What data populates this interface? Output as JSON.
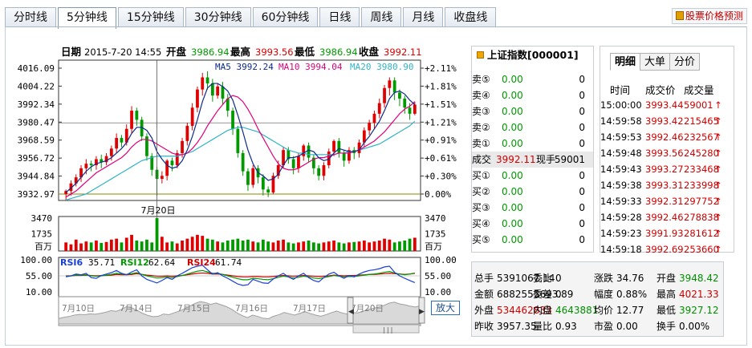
{
  "tabs": [
    "分时线",
    "5分钟线",
    "15分钟线",
    "30分钟线",
    "60分钟线",
    "日线",
    "周线",
    "月线",
    "收盘线"
  ],
  "active_tab": 1,
  "predict_label": "股票价格预测",
  "kline": {
    "date_label": "日期",
    "date_value": "2015-7-20 14:55",
    "open_label": "开盘",
    "open_value": "3986.94",
    "high_label": "最高",
    "high_value": "3993.56",
    "low_label": "最低",
    "low_value": "3986.94",
    "close_label": "收盘",
    "close_value": "3992.11",
    "ma5_label": "MA5",
    "ma5_value": "3992.24",
    "ma10_label": "MA10",
    "ma10_value": "3994.04",
    "ma20_label": "MA20",
    "ma20_value": "3980.90",
    "date_marker": "7月20日",
    "vol_unit": "百万",
    "rsi6_label": "RSI6",
    "rsi6_value": "35.71",
    "rsi12_label": "RSI12",
    "rsi12_value": "62.64",
    "rsi24_label": "RSI24",
    "rsi24_value": "61.74",
    "expand_label": "放大",
    "nav_dates": [
      "7月10日",
      "7月14日",
      "7月15日",
      "7月16日",
      "7月17日",
      "7月20日"
    ],
    "colors": {
      "up": "#e00000",
      "down": "#009900",
      "ma5": "#0b2a8c",
      "ma10": "#e0007a",
      "ma20": "#2fb3c8",
      "rsi6": "#1a3fd8",
      "rsi12": "#009900",
      "rsi24": "#d00000"
    }
  },
  "chart_data": {
    "type": "candlestick",
    "price_ticks": [
      "4016.09",
      "4004.22",
      "3992.34",
      "3980.47",
      "3968.59",
      "3956.72",
      "3944.84",
      "3932.97"
    ],
    "pct_ticks": [
      "+2.11%",
      "+1.81%",
      "+1.51%",
      "+1.21%",
      "+0.91%",
      "+0.61%",
      "+0.30%",
      "0.00%"
    ],
    "price_range": [
      3932.97,
      4016.09
    ],
    "volume_ticks": [
      "3470",
      "1735"
    ],
    "volume_range": [
      0,
      3470
    ],
    "rsi_ticks": [
      "100.00",
      "55.00",
      "10.00"
    ],
    "rsi_range": [
      10,
      100
    ],
    "candles": [
      [
        3933,
        3935,
        3929,
        3936
      ],
      [
        3935,
        3940,
        3932,
        3942
      ],
      [
        3940,
        3944,
        3938,
        3946
      ],
      [
        3944,
        3950,
        3941,
        3952
      ],
      [
        3950,
        3953,
        3946,
        3956
      ],
      [
        3953,
        3952,
        3948,
        3955
      ],
      [
        3952,
        3956,
        3949,
        3958
      ],
      [
        3956,
        3954,
        3950,
        3959
      ],
      [
        3954,
        3958,
        3952,
        3960
      ],
      [
        3958,
        3963,
        3955,
        3965
      ],
      [
        3963,
        3970,
        3960,
        3973
      ],
      [
        3970,
        3967,
        3964,
        3972
      ],
      [
        3967,
        3976,
        3965,
        3979
      ],
      [
        3976,
        3988,
        3973,
        3991
      ],
      [
        3988,
        3982,
        3978,
        3990
      ],
      [
        3982,
        3971,
        3968,
        3984
      ],
      [
        3971,
        3958,
        3955,
        3973
      ],
      [
        3958,
        3949,
        3945,
        3960
      ],
      [
        3949,
        3943,
        3932,
        3951
      ],
      [
        3943,
        3945,
        3940,
        3948
      ],
      [
        3945,
        3955,
        3942,
        3956
      ],
      [
        3955,
        3952,
        3948,
        3957
      ],
      [
        3952,
        3960,
        3950,
        3962
      ],
      [
        3960,
        3968,
        3957,
        3970
      ],
      [
        3968,
        3978,
        3965,
        3980
      ],
      [
        3978,
        3990,
        3975,
        3993
      ],
      [
        3990,
        4002,
        3987,
        4004
      ],
      [
        4002,
        4010,
        3998,
        4013
      ],
      [
        4010,
        4006,
        4002,
        4014
      ],
      [
        4006,
        3998,
        3994,
        4009
      ],
      [
        3998,
        4004,
        3996,
        4006
      ],
      [
        4004,
        3996,
        3992,
        4007
      ],
      [
        3996,
        3988,
        3984,
        3999
      ],
      [
        3988,
        3976,
        3972,
        3990
      ],
      [
        3976,
        3960,
        3957,
        3978
      ],
      [
        3960,
        3948,
        3945,
        3962
      ],
      [
        3948,
        3939,
        3935,
        3950
      ],
      [
        3939,
        3950,
        3937,
        3952
      ],
      [
        3950,
        3944,
        3940,
        3952
      ],
      [
        3944,
        3936,
        3932,
        3946
      ],
      [
        3936,
        3934,
        3931,
        3938
      ],
      [
        3934,
        3945,
        3933,
        3947
      ],
      [
        3945,
        3952,
        3943,
        3955
      ],
      [
        3952,
        3962,
        3950,
        3964
      ],
      [
        3962,
        3956,
        3953,
        3964
      ],
      [
        3956,
        3950,
        3946,
        3958
      ],
      [
        3950,
        3958,
        3947,
        3960
      ],
      [
        3958,
        3965,
        3955,
        3966
      ],
      [
        3965,
        3957,
        3954,
        3967
      ],
      [
        3957,
        3950,
        3946,
        3959
      ],
      [
        3950,
        3945,
        3942,
        3952
      ],
      [
        3945,
        3952,
        3942,
        3954
      ],
      [
        3952,
        3961,
        3950,
        3963
      ],
      [
        3961,
        3968,
        3958,
        3969
      ],
      [
        3968,
        3960,
        3957,
        3970
      ],
      [
        3960,
        3955,
        3951,
        3962
      ],
      [
        3955,
        3962,
        3953,
        3964
      ],
      [
        3962,
        3960,
        3956,
        3964
      ],
      [
        3960,
        3967,
        3957,
        3969
      ],
      [
        3967,
        3975,
        3964,
        3977
      ],
      [
        3975,
        3980,
        3972,
        3982
      ],
      [
        3980,
        3986,
        3976,
        3988
      ],
      [
        3986,
        3993,
        3983,
        3996
      ],
      [
        3993,
        4003,
        3990,
        4005
      ],
      [
        4003,
        4008,
        3998,
        4010
      ],
      [
        4008,
        4000,
        3995,
        4010
      ],
      [
        4000,
        3996,
        3991,
        4002
      ],
      [
        3996,
        3990,
        3986,
        3998
      ],
      [
        3990,
        3986,
        3982,
        3993
      ],
      [
        3986,
        3992,
        3985,
        3994
      ]
    ],
    "ma5": [
      3934,
      3937,
      3940,
      3944,
      3948,
      3951,
      3953,
      3954,
      3955,
      3957,
      3960,
      3963,
      3967,
      3973,
      3977,
      3977,
      3975,
      3970,
      3961,
      3956,
      3952,
      3950,
      3951,
      3955,
      3962,
      3971,
      3982,
      3994,
      4003,
      4006,
      4006,
      4004,
      4001,
      3995,
      3985,
      3974,
      3962,
      3953,
      3947,
      3945,
      3942,
      3943,
      3946,
      3952,
      3957,
      3957,
      3958,
      3960,
      3962,
      3961,
      3957,
      3955,
      3956,
      3960,
      3963,
      3962,
      3961,
      3961,
      3962,
      3967,
      3971,
      3976,
      3981,
      3988,
      3996,
      4000,
      4001,
      3999,
      3995,
      3992
    ],
    "ma10": [
      3931,
      3933,
      3935,
      3938,
      3941,
      3944,
      3947,
      3949,
      3951,
      3953,
      3955,
      3957,
      3960,
      3964,
      3967,
      3969,
      3969,
      3968,
      3966,
      3964,
      3962,
      3960,
      3959,
      3959,
      3960,
      3963,
      3967,
      3972,
      3978,
      3983,
      3988,
      3992,
      3996,
      3998,
      3997,
      3994,
      3989,
      3983,
      3976,
      3970,
      3964,
      3958,
      3953,
      3950,
      3949,
      3949,
      3950,
      3952,
      3954,
      3956,
      3957,
      3957,
      3958,
      3959,
      3960,
      3960,
      3960,
      3961,
      3962,
      3964,
      3966,
      3968,
      3971,
      3974,
      3978,
      3982,
      3986,
      3989,
      3991,
      3994
    ],
    "ma20": [
      3929,
      3930,
      3931,
      3932,
      3933,
      3935,
      3937,
      3939,
      3941,
      3943,
      3945,
      3947,
      3949,
      3951,
      3953,
      3955,
      3956,
      3957,
      3958,
      3958,
      3958,
      3958,
      3958,
      3959,
      3960,
      3961,
      3963,
      3965,
      3967,
      3969,
      3971,
      3973,
      3975,
      3976,
      3977,
      3977,
      3976,
      3975,
      3974,
      3972,
      3970,
      3968,
      3966,
      3964,
      3962,
      3961,
      3960,
      3960,
      3959,
      3959,
      3959,
      3959,
      3959,
      3959,
      3960,
      3960,
      3961,
      3961,
      3962,
      3963,
      3964,
      3965,
      3966,
      3968,
      3970,
      3972,
      3974,
      3976,
      3978,
      3981
    ],
    "volume": [
      900,
      700,
      1200,
      800,
      1000,
      900,
      1100,
      850,
      950,
      1200,
      1300,
      900,
      1400,
      1700,
      1100,
      1000,
      1200,
      900,
      3470,
      1500,
      900,
      1000,
      800,
      1100,
      1300,
      1500,
      1700,
      1600,
      1300,
      1200,
      1000,
      900,
      1100,
      1200,
      1300,
      1100,
      1200,
      1000,
      900,
      1200,
      1000,
      900,
      1100,
      1200,
      900,
      800,
      900,
      1000,
      1100,
      900,
      800,
      900,
      1000,
      1100,
      900,
      800,
      900,
      950,
      1000,
      1100,
      900,
      1000,
      1100,
      1300,
      1200,
      900,
      1000,
      1100,
      1300,
      1400
    ],
    "rsi6": [
      52,
      55,
      60,
      58,
      62,
      50,
      48,
      56,
      60,
      64,
      70,
      62,
      58,
      66,
      72,
      55,
      45,
      40,
      35,
      42,
      50,
      45,
      55,
      62,
      70,
      78,
      82,
      85,
      72,
      60,
      64,
      55,
      48,
      40,
      32,
      28,
      30,
      45,
      40,
      35,
      34,
      46,
      55,
      62,
      52,
      45,
      55,
      62,
      50,
      42,
      38,
      50,
      60,
      65,
      55,
      48,
      56,
      52,
      60,
      66,
      70,
      72,
      75,
      80,
      82,
      65,
      55,
      48,
      42,
      36
    ],
    "rsi12": [
      54,
      55,
      57,
      57,
      58,
      55,
      54,
      55,
      57,
      59,
      62,
      60,
      59,
      61,
      64,
      59,
      55,
      52,
      49,
      50,
      52,
      50,
      53,
      56,
      60,
      64,
      68,
      70,
      66,
      62,
      62,
      59,
      55,
      51,
      47,
      44,
      44,
      48,
      47,
      45,
      44,
      47,
      51,
      54,
      52,
      49,
      51,
      54,
      52,
      49,
      47,
      50,
      53,
      56,
      54,
      52,
      53,
      53,
      55,
      57,
      59,
      60,
      62,
      65,
      67,
      63,
      60,
      58,
      60,
      63
    ],
    "rsi24": [
      55,
      55,
      56,
      56,
      57,
      56,
      55,
      56,
      56,
      57,
      59,
      58,
      58,
      59,
      61,
      59,
      57,
      56,
      54,
      54,
      55,
      54,
      55,
      56,
      58,
      60,
      62,
      63,
      62,
      60,
      60,
      59,
      57,
      55,
      53,
      52,
      52,
      53,
      53,
      52,
      52,
      53,
      55,
      56,
      55,
      54,
      55,
      56,
      55,
      54,
      53,
      54,
      55,
      57,
      56,
      55,
      56,
      56,
      57,
      58,
      59,
      59,
      60,
      61,
      62,
      61,
      60,
      59,
      60,
      62
    ]
  },
  "quote": {
    "title": "上证指数[000001]",
    "sell": [
      {
        "label": "卖⑤",
        "price": "0.00",
        "vol": "0"
      },
      {
        "label": "卖④",
        "price": "0.00",
        "vol": "0"
      },
      {
        "label": "卖③",
        "price": "0.00",
        "vol": "0"
      },
      {
        "label": "卖②",
        "price": "0.00",
        "vol": "0"
      },
      {
        "label": "卖①",
        "price": "0.00",
        "vol": "0"
      }
    ],
    "deal_label": "成交",
    "deal_price": "3992.11",
    "now_label": "现手",
    "now_vol": "59001",
    "buy": [
      {
        "label": "买①",
        "price": "0.00",
        "vol": "0"
      },
      {
        "label": "买②",
        "price": "0.00",
        "vol": "0"
      },
      {
        "label": "买③",
        "price": "0.00",
        "vol": "0"
      },
      {
        "label": "买④",
        "price": "0.00",
        "vol": "0"
      },
      {
        "label": "买⑤",
        "price": "0.00",
        "vol": "0"
      }
    ]
  },
  "detail": {
    "tabs": [
      "明细",
      "大单",
      "分价"
    ],
    "headers": [
      "时间",
      "成交价",
      "成交量"
    ],
    "rows": [
      {
        "time": "15:00:00",
        "price": "3993.44",
        "vol": "59001"
      },
      {
        "time": "14:59:58",
        "price": "3993.42",
        "vol": "215465"
      },
      {
        "time": "14:59:53",
        "price": "3992.46",
        "vol": "232567"
      },
      {
        "time": "14:59:48",
        "price": "3993.56",
        "vol": "245280"
      },
      {
        "time": "14:59:43",
        "price": "3993.27",
        "vol": "233468"
      },
      {
        "time": "14:59:38",
        "price": "3993.31",
        "vol": "233998"
      },
      {
        "time": "14:59:33",
        "price": "3992.31",
        "vol": "297752"
      },
      {
        "time": "14:59:28",
        "price": "3992.46",
        "vol": "278838"
      },
      {
        "time": "14:59:23",
        "price": "3991.93",
        "vol": "281612"
      },
      {
        "time": "14:59:18",
        "price": "3992.69",
        "vol": "253660"
      }
    ],
    "arrow": "↑"
  },
  "summary": {
    "r1": [
      [
        "总手",
        "5391067.14"
      ],
      [
        "委比",
        "0"
      ],
      [
        "涨跌",
        "34.76"
      ],
      [
        "开盘",
        "3948.42"
      ]
    ],
    "r2": [
      [
        "金额",
        "6882555693.89"
      ],
      [
        "委差",
        "0"
      ],
      [
        "幅度",
        "0.88%"
      ],
      [
        "最高",
        "4021.33"
      ]
    ],
    "r3": [
      [
        "外盘",
        "534462833"
      ],
      [
        "内盘",
        "4643881"
      ],
      [
        "均价",
        "12.77"
      ],
      [
        "最低",
        "3927.12"
      ]
    ],
    "r4": [
      [
        "昨收",
        "3957.35"
      ],
      [
        "量比",
        "0.93"
      ],
      [
        "市盈",
        "0.00"
      ],
      [
        "换手",
        "0.00%"
      ]
    ]
  }
}
